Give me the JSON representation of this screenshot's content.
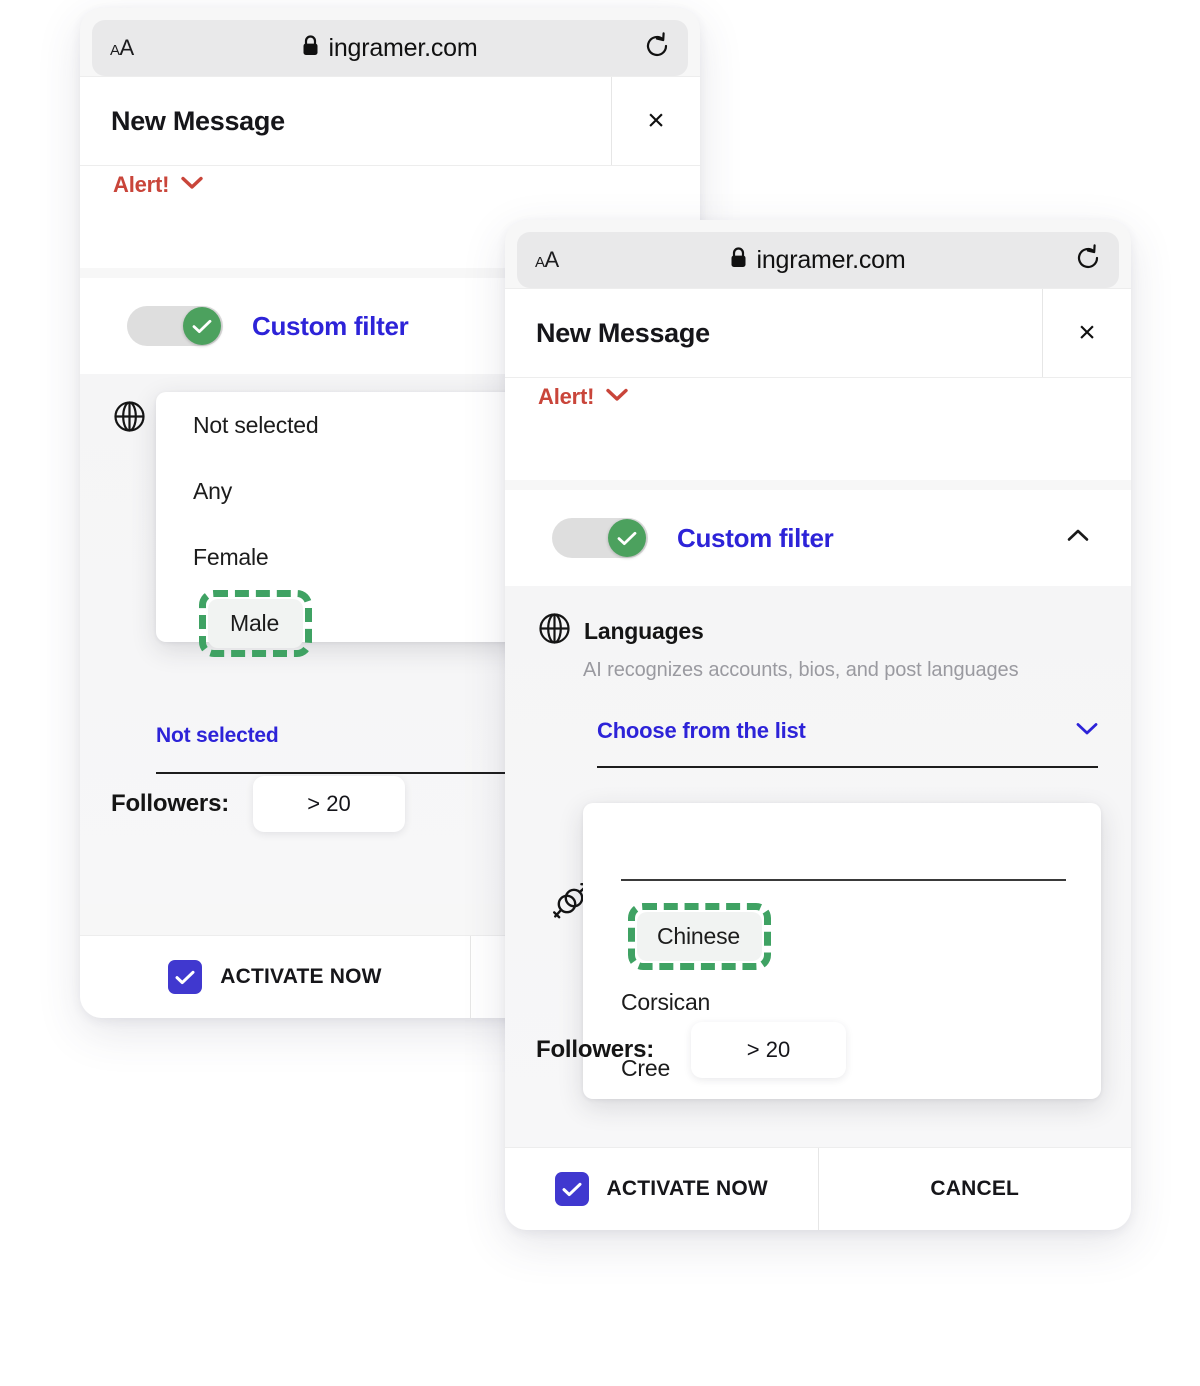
{
  "browser": {
    "text_size_label": "AA",
    "host": "ingramer.com",
    "lock_icon": "lock-icon",
    "reload_icon": "reload-icon"
  },
  "modal": {
    "title": "New Message",
    "close_label": "×"
  },
  "alert": {
    "text": "Alert!",
    "chevron_icon": "chevron-down-icon",
    "color": "#c9453a"
  },
  "custom_filter": {
    "label": "Custom filter",
    "enabled": true,
    "toggle_check_icon": "check-icon",
    "collapse_chevron_icon": "chevron-up-icon",
    "accent_color": "#2d23d8",
    "toggle_on_color": "#4ca15e"
  },
  "languages": {
    "icon": "globe-icon",
    "title": "Languages",
    "subtitle": "AI recognizes accounts, bios, and post languages",
    "choose_label": "Choose from the list",
    "choose_chevron_icon": "chevron-down-icon",
    "search_value": "",
    "search_placeholder": ""
  },
  "gender": {
    "icon": "gender-icon",
    "selected_label": "Not selected"
  },
  "gender_options": [
    {
      "label": "Not selected",
      "highlighted": false
    },
    {
      "label": "Any",
      "highlighted": false
    },
    {
      "label": "Female",
      "highlighted": false
    },
    {
      "label": "Male",
      "highlighted": true
    }
  ],
  "language_options": [
    {
      "label": "Chinese",
      "highlighted": true
    },
    {
      "label": "Corsican",
      "highlighted": false
    },
    {
      "label": "Cree",
      "highlighted": false
    }
  ],
  "followers": {
    "label": "Followers:",
    "value": "> 20"
  },
  "footer": {
    "activate_label": "ACTIVATE NOW",
    "activate_checked": true,
    "cancel_label": "CANCEL",
    "checkbox_icon": "check-icon",
    "checkbox_color": "#4038cf"
  },
  "highlight": {
    "color": "#3fa263",
    "style": "dashed"
  }
}
